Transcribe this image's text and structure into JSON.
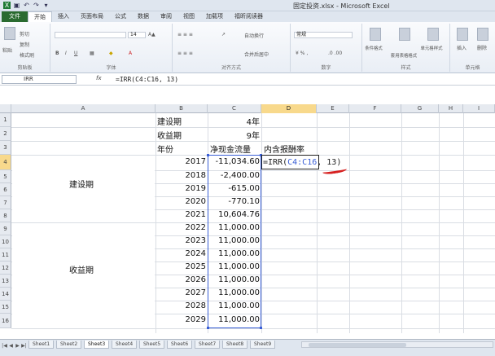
{
  "window": {
    "title": "固定投资.xlsx - Microsoft Excel"
  },
  "ribbon": {
    "tabs": [
      "文件",
      "开始",
      "插入",
      "页面布局",
      "公式",
      "数据",
      "审阅",
      "视图",
      "加载项",
      "福昕阅读器"
    ],
    "active_tab": "开始",
    "clipboard": {
      "paste": "粘贴",
      "cut": "剪切",
      "copy": "复制",
      "format_painter": "格式刷",
      "label": "剪贴板"
    },
    "font": {
      "size": "14",
      "label": "字体"
    },
    "alignment": {
      "wrap": "自动换行",
      "merge": "合并后居中",
      "label": "对齐方式"
    },
    "number": {
      "format": "常规",
      "label": "数字"
    },
    "styles": {
      "conditional": "条件格式",
      "table": "套用表格格式",
      "cell": "单元格样式",
      "label": "样式"
    },
    "cells": {
      "insert": "插入",
      "delete": "删除",
      "label": "单元格"
    }
  },
  "formula_bar": {
    "name_box": "IRR",
    "fx": "fx",
    "formula": "=IRR(C4:C16, 13)"
  },
  "columns": [
    "A",
    "B",
    "C",
    "D",
    "E",
    "F",
    "G",
    "H",
    "I"
  ],
  "rows": [
    "1",
    "2",
    "3",
    "4",
    "5",
    "6",
    "7",
    "8",
    "9",
    "10",
    "11",
    "12",
    "13",
    "14",
    "15",
    "16"
  ],
  "sheet": {
    "b1": "建设期",
    "c1": "4年",
    "b2": "收益期",
    "c2": "9年",
    "b3": "年份",
    "c3": "净现金流量",
    "d3": "内含报酬率",
    "a_construction": "建设期",
    "a_income": "收益期",
    "years": [
      "2017",
      "2018",
      "2019",
      "2020",
      "2021",
      "2022",
      "2023",
      "2024",
      "2025",
      "2026",
      "2027",
      "2028",
      "2029"
    ],
    "cashflows": [
      "-11,034.60",
      "-2,400.00",
      "-615.00",
      "-770.10",
      "10,604.76",
      "11,000.00",
      "11,000.00",
      "11,000.00",
      "11,000.00",
      "11,000.00",
      "11,000.00",
      "11,000.00",
      "11,000.00"
    ],
    "editing": {
      "prefix": "=IRR(",
      "range": "C4:C16",
      "suffix": ", 13)"
    }
  },
  "sheet_tabs": [
    "Sheet1",
    "Sheet2",
    "Sheet3",
    "Sheet4",
    "Sheet5",
    "Sheet6",
    "Sheet7",
    "Sheet8",
    "Sheet9"
  ],
  "active_sheet": "Sheet3",
  "colors": {
    "range_border": "#3a5fd6",
    "annotation": "#d62020",
    "file_tab": "#2a6b30"
  }
}
